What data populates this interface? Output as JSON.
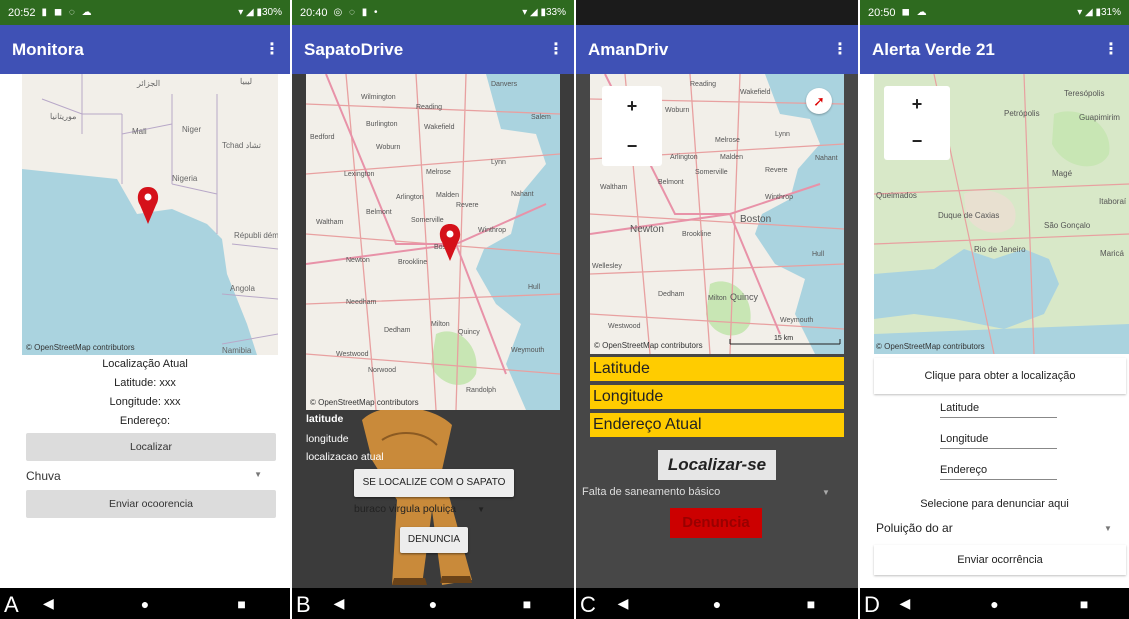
{
  "panels": [
    {
      "letter": "A",
      "status": {
        "time": "20:52",
        "icons": "▮ ◼ ◌ ☁",
        "right": "▾ ◢ ▮30%"
      },
      "app_title": "Monitora",
      "map": {
        "labels": [
          "الجزائر",
          "ليبيا",
          "موريتانيا",
          "Mali",
          "Niger",
          "Tchad تشاد",
          "Nigeria",
          "Républi démocrat du Con",
          "Angola",
          "Namibia"
        ],
        "attribution": "© OpenStreetMap contributors"
      },
      "lines": [
        "Localização Atual",
        "Latitude: xxx",
        "Longitude: xxx",
        "Endereço:"
      ],
      "localizar_label": "Localizar",
      "spinner_value": "Chuva",
      "send_label": "Enviar ocoorencia"
    },
    {
      "letter": "B",
      "status": {
        "time": "20:40",
        "icons": "◎ ◌ ▮ •",
        "right": "▾ ◢ ▮33%"
      },
      "app_title": "SapatoDrive",
      "map": {
        "labels": [
          "Danvers",
          "Wilmington",
          "Reading",
          "Salem",
          "Burlington",
          "Wakefield",
          "Bedford",
          "Woburn",
          "Lexington",
          "Melrose",
          "Lynn",
          "Arlington",
          "Malden",
          "Nahant",
          "Belmont",
          "Somerville",
          "Revere",
          "Waltham",
          "Boston",
          "Winthrop",
          "Newton",
          "Brookline",
          "Hull",
          "Needham",
          "Dedham",
          "Milton",
          "Quincy",
          "Westwood",
          "Norwood",
          "Randolph",
          "Weymouth"
        ],
        "attribution": "© OpenStreetMap contributors"
      },
      "labels": [
        "latitude",
        "longitude",
        "localizacao atual"
      ],
      "locate_label": "SE LOCALIZE COM O SAPATO",
      "spinner_value": "buraco virgula poluiça",
      "denuncia_label": "DENUNCIA"
    },
    {
      "letter": "C",
      "status": {
        "time": "",
        "icons": "",
        "right": ""
      },
      "app_title": "AmanDriv",
      "map": {
        "labels": [
          "Reading",
          "Wakefield",
          "Woburn",
          "Melrose",
          "Lynn",
          "Malden",
          "Arlington",
          "Revere",
          "Nahant",
          "Belmont",
          "Somerville",
          "Winthrop",
          "Waltham",
          "Boston",
          "Newton",
          "Brookline",
          "Hull",
          "Wellesley",
          "Dedham",
          "Milton",
          "Quincy",
          "Westwood",
          "Weymouth"
        ],
        "attribution": "© OpenStreetMap contributors",
        "scale": "15 km"
      },
      "bars": [
        "Latitude",
        "Longitude",
        "Endereço Atual"
      ],
      "locate_label": "Localizar-se",
      "spinner_value": "Falta de saneamento básico",
      "denuncia_label": "Denuncia"
    },
    {
      "letter": "D",
      "status": {
        "time": "20:50",
        "icons": "◼ ☁",
        "right": "▾ ◢ ▮31%"
      },
      "app_title": "Alerta Verde 21",
      "map": {
        "labels": [
          "Teresópolis",
          "Petrópolis",
          "Guapimirim",
          "Magé",
          "Queimados",
          "Duque de Caxias",
          "Itaboraí",
          "São Gonçalo",
          "Rio de Janeiro",
          "Maricá"
        ],
        "attribution": "© OpenStreetMap contributors"
      },
      "click_label": "Clique para obter a localização",
      "fields": [
        "Latitude",
        "Longitude",
        "Endereço"
      ],
      "select_label": "Selecione para denunciar aqui",
      "spinner_value": "Poluição do ar",
      "send_label": "Enviar ocorrência"
    }
  ],
  "colors": {
    "appbar": "#3f51b5",
    "statusbar": "#2e6a1f",
    "map_land": "#f2efe9",
    "map_water": "#aad3df",
    "map_green": "#c8e6b4",
    "pin": "#d5111a",
    "yellow": "#ffcc00",
    "red_button": "#cc0000"
  }
}
